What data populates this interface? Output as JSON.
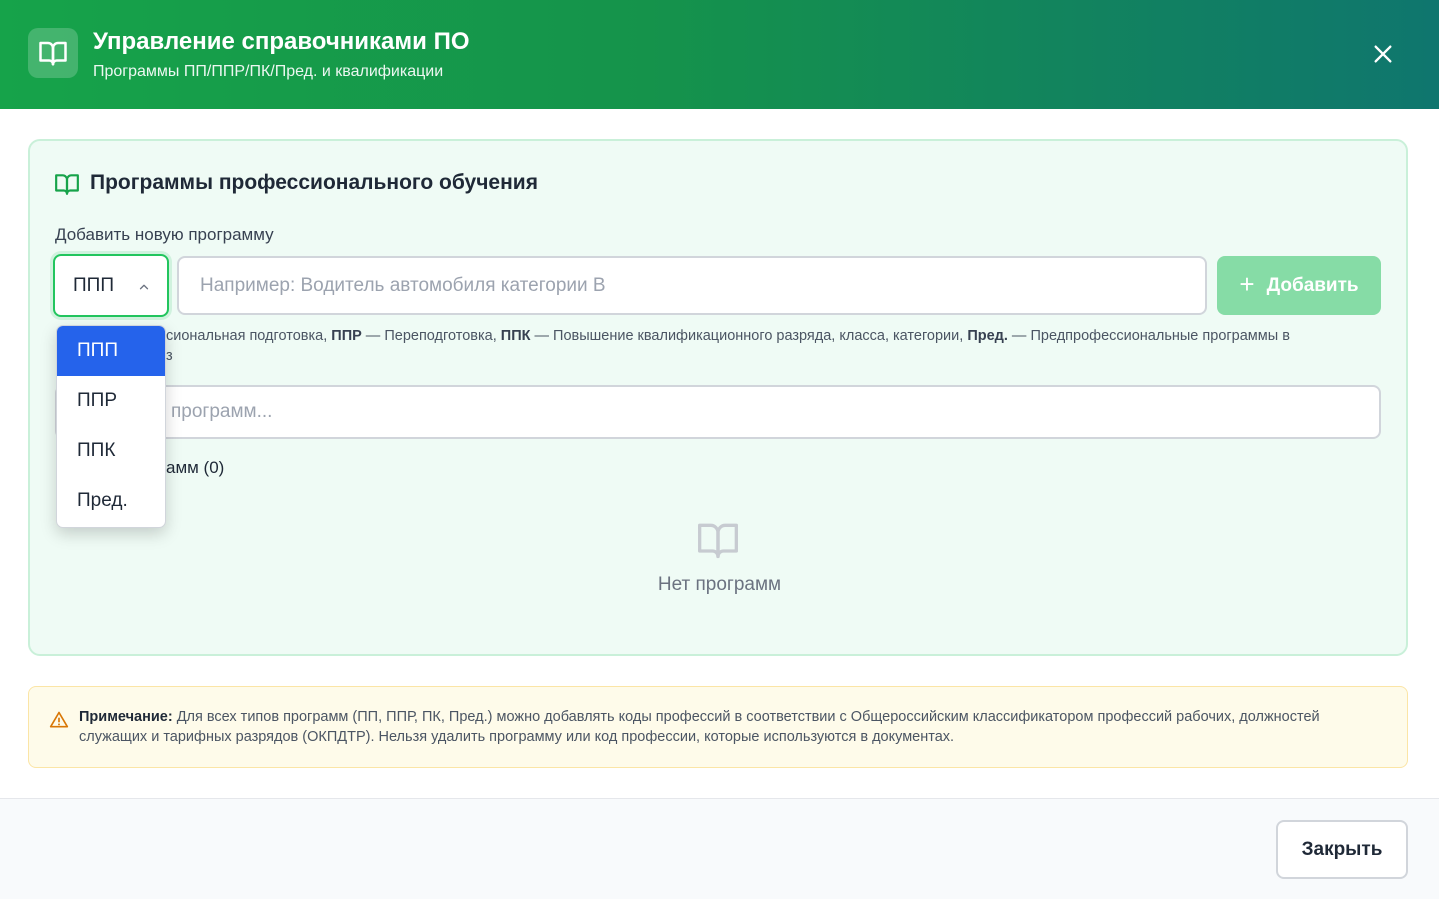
{
  "header": {
    "title": "Управление справочниками ПО",
    "subtitle": "Программы ПП/ППР/ПК/Пред. и квалификации"
  },
  "card": {
    "title": "Программы профессионального обучения",
    "add_label": "Добавить новую программу",
    "select": {
      "value": "ППП"
    },
    "name_input": {
      "value": "",
      "placeholder": "Например: Водитель автомобиля категории В"
    },
    "add_button": "Добавить",
    "legend": {
      "line1_fragment": "сиональная подготовка, ",
      "ppr_abbr": "ППР",
      "ppr_desc": " — Переподготовка, ",
      "ppk_abbr": "ППК",
      "ppk_desc": " — Повышение квалификационного разряда, класса, категории, ",
      "pred_abbr": "Пред.",
      "pred_desc": " — Предпрофессиональные программы в",
      "line2_fragment": "з"
    },
    "search_input": {
      "value": "",
      "placeholder": "программ..."
    },
    "count_label": "амм (0)",
    "empty_text": "Нет программ"
  },
  "dropdown": {
    "options": [
      "ППП",
      "ППР",
      "ППК",
      "Пред."
    ],
    "selected_index": 0
  },
  "note": {
    "label": "Примечание:",
    "text": " Для всех типов программ (ПП, ППР, ПК, Пред.) можно добавлять коды профессий в соответствии с Общероссийским классификатором профессий рабочих, должностей служащих и тарифных разрядов (ОКПДТР). Нельзя удалить программу или код профессии, которые используются в документах."
  },
  "footer": {
    "close_button": "Закрыть"
  },
  "colors": {
    "header_gradient_start": "#16a34a",
    "header_gradient_end": "#0f766e",
    "accent_green": "#22c55e",
    "add_button_bg": "#86dca6",
    "dropdown_selected_bg": "#2563eb",
    "card_bg": "#effbf5",
    "note_bg": "#fefbea"
  }
}
